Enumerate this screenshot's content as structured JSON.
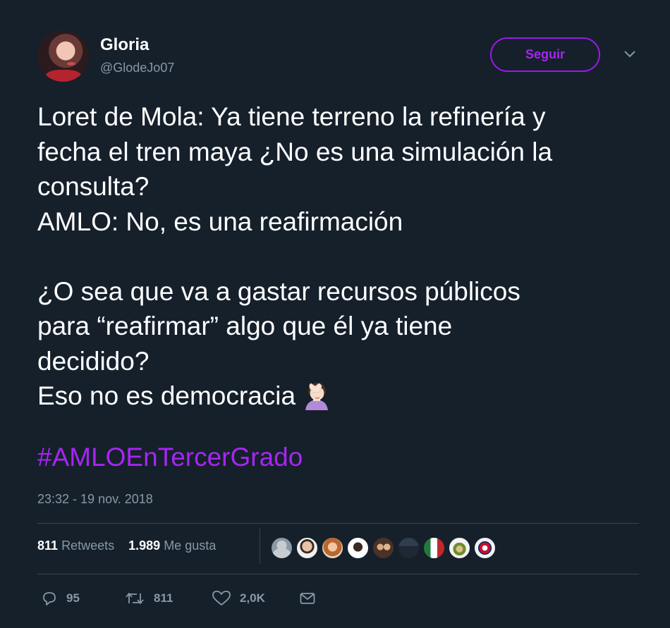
{
  "user": {
    "name": "Gloria",
    "handle": "@GlodeJo07",
    "follow_label": "Seguir"
  },
  "tweet": {
    "lines": [
      "Loret de Mola: Ya tiene terreno la refinería y",
      "fecha el tren maya ¿No es una simulación la",
      "consulta?",
      "AMLO: No, es una reafirmación",
      "",
      "¿O sea que va a gastar recursos públicos",
      "para “reafirmar” algo que él ya tiene",
      "decidido?",
      "Eso no es democracia"
    ],
    "emoji": "woman-facepalming-icon",
    "hashtag": "#AMLOEnTercerGrado",
    "timestamp": "23:32 - 19 nov. 2018"
  },
  "stats": {
    "retweets_count": "811",
    "retweets_label": "Retweets",
    "likes_count": "1.989",
    "likes_label": "Me gusta"
  },
  "actions": {
    "replies": "95",
    "retweets": "811",
    "likes": "2,0K"
  },
  "colors": {
    "background": "#15202b",
    "accent": "#a725f3",
    "muted": "#8899a6",
    "divider": "#38444d"
  }
}
